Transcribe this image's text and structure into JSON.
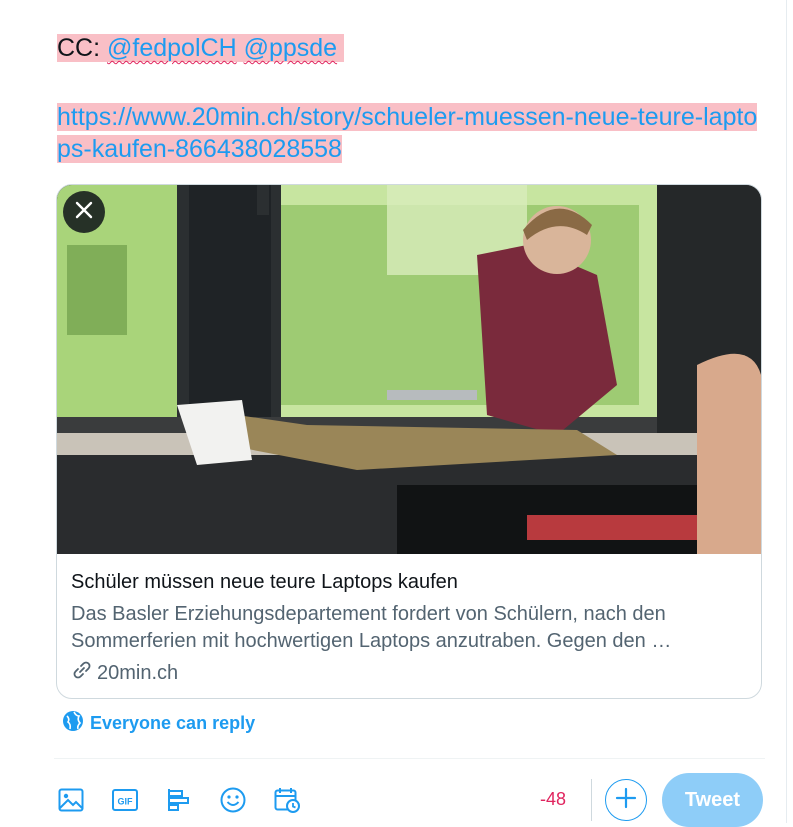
{
  "composer": {
    "cc_prefix": "CC:",
    "mentions": [
      "@fedpolCH",
      "@ppsde"
    ],
    "url": "https://www.20min.ch/story/schueler-muessen-neue-teure-laptops-kaufen-866438028558"
  },
  "link_card": {
    "title": "Schüler müssen neue teure Laptops kaufen",
    "description": "Das Basler Erziehungsdepartement fordert von Schülern, nach den Sommerferien mit hochwertigen Laptops anzutraben. Gegen den …",
    "domain": "20min.ch",
    "close_icon": "close-icon",
    "link_icon": "link-icon"
  },
  "reply_setting": {
    "icon": "globe-icon",
    "label": "Everyone can reply"
  },
  "toolbar": {
    "icons": [
      "image-icon",
      "gif-icon",
      "poll-icon",
      "emoji-icon",
      "schedule-icon"
    ],
    "char_count": "-48",
    "add_icon": "plus-icon",
    "tweet_label": "Tweet"
  },
  "colors": {
    "accent": "#1d9bf0",
    "highlight": "#f9bfc6",
    "over_limit": "#e0245e",
    "tweet_disabled": "#8ecdf8"
  }
}
